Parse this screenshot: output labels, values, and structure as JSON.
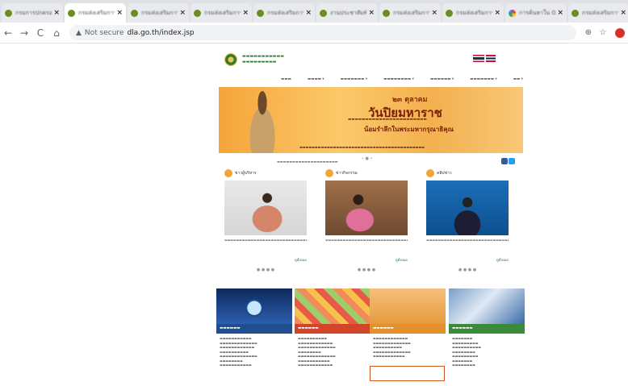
{
  "browser": {
    "tabs": [
      {
        "title": "กรมการปกครองส่วนท้องถิ่น",
        "active": false,
        "favicon": "green-seal-icon"
      },
      {
        "title": "กรมส่งเสริมการปกครองท้องถิ่น",
        "active": true,
        "favicon": "green-seal-icon"
      },
      {
        "title": "กรมส่งเสริมการปกครองท้องถิ่น",
        "active": false,
        "favicon": "green-seal-icon"
      },
      {
        "title": "กรมส่งเสริมการปกครองท้องถิ่น",
        "active": false,
        "favicon": "green-seal-icon"
      },
      {
        "title": "กรมส่งเสริมการปกครองท้องถิ่น",
        "active": false,
        "favicon": "green-seal-icon"
      },
      {
        "title": "งานประชาสัมพันธ์",
        "active": false,
        "favicon": "green-seal-icon"
      },
      {
        "title": "กรมส่งเสริมการปกครองท้องถิ่น",
        "active": false,
        "favicon": "green-seal-icon"
      },
      {
        "title": "กรมส่งเสริมการปกครองท้องถิ่น",
        "active": false,
        "favicon": "green-seal-icon"
      },
      {
        "title": "การค้นหาใน Google",
        "active": false,
        "favicon": "google-icon"
      },
      {
        "title": "กรมส่งเสริมการปกครองท้องถิ่น",
        "active": false,
        "favicon": "green-seal-icon"
      }
    ],
    "new_tab_symbol": "+",
    "not_secure_label": "Not secure",
    "url": "dla.go.th/index.jsp"
  },
  "site": {
    "banner": {
      "date": "๒๓ ตุลาคม",
      "title": "วันปิยมหาราช",
      "subtitle_line": "น้อมรำลึกในพระมหากรุณาธิคุณ"
    },
    "news_columns": [
      {
        "heading": "ข่าวผู้บริหาร",
        "more": "ดูทั้งหมด"
      },
      {
        "heading": "ข่าวกิจกรรม",
        "more": "ดูทั้งหมด"
      },
      {
        "heading": "คลิปข่าว",
        "more": "ดูทั้งหมด"
      }
    ]
  }
}
